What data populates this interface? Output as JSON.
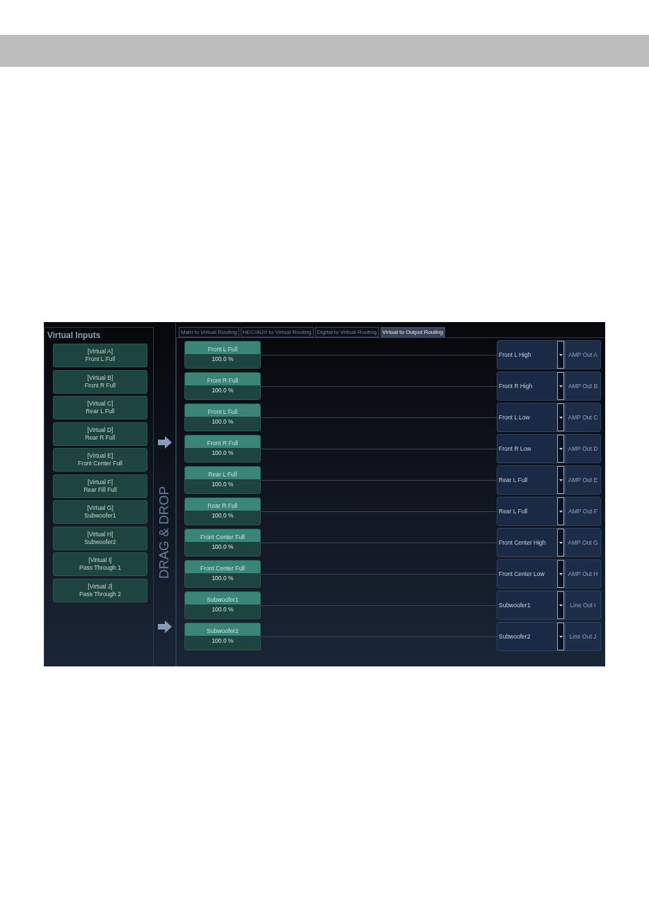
{
  "sidebar": {
    "title": "Virtual Inputs",
    "items": [
      {
        "id_label": "[Virtual A]",
        "name": "Front L Full"
      },
      {
        "id_label": "[Virtual B]",
        "name": "Front R Full"
      },
      {
        "id_label": "[Virtual C]",
        "name": "Rear L Full"
      },
      {
        "id_label": "[Virtual D]",
        "name": "Rear R Full"
      },
      {
        "id_label": "[Virtual E]",
        "name": "Front Center Full"
      },
      {
        "id_label": "[Virtual F]",
        "name": "Rear Fill Full"
      },
      {
        "id_label": "[Virtual G]",
        "name": "Subwoofer1"
      },
      {
        "id_label": "[Virtual H]",
        "name": "Subwoofer2"
      },
      {
        "id_label": "[Virtual I]",
        "name": "Pass Through 1"
      },
      {
        "id_label": "[Virtual J]",
        "name": "Pass Through 2"
      }
    ]
  },
  "drag_hint": "DRAG & DROP",
  "tabs": [
    {
      "label": "Main to Virtual Routing",
      "selected": false
    },
    {
      "label": "HEC/AUX to Virtual Routing",
      "selected": false
    },
    {
      "label": "Digital to Virtual Routing",
      "selected": false
    },
    {
      "label": "Virtual to Output Routing",
      "selected": true
    }
  ],
  "routes": [
    {
      "source": "Front L Full",
      "gain": "100.0 %",
      "assigned": "Front L High",
      "output": "AMP Out A"
    },
    {
      "source": "Front R Full",
      "gain": "100.0 %",
      "assigned": "Front R High",
      "output": "AMP Out B"
    },
    {
      "source": "Front L Full",
      "gain": "100.0 %",
      "assigned": "Front L Low",
      "output": "AMP Out C"
    },
    {
      "source": "Front R Full",
      "gain": "100.0 %",
      "assigned": "Front R Low",
      "output": "AMP Out D"
    },
    {
      "source": "Rear L Full",
      "gain": "100.0 %",
      "assigned": "Rear L Full",
      "output": "AMP Out E"
    },
    {
      "source": "Rear R Full",
      "gain": "100.0 %",
      "assigned": "Rear L Full",
      "output": "AMP Out F"
    },
    {
      "source": "Front Center Full",
      "gain": "100.0 %",
      "assigned": "Front Center High",
      "output": "AMP Out G"
    },
    {
      "source": "Front Center Full",
      "gain": "100.0 %",
      "assigned": "Front Center Low",
      "output": "AMP Out H"
    },
    {
      "source": "Subwoofer1",
      "gain": "100.0 %",
      "assigned": "Subwoofer1",
      "output": "Line Out I"
    },
    {
      "source": "Subwoofer2",
      "gain": "100.0 %",
      "assigned": "Subwoofer2",
      "output": "Line Out J"
    }
  ]
}
